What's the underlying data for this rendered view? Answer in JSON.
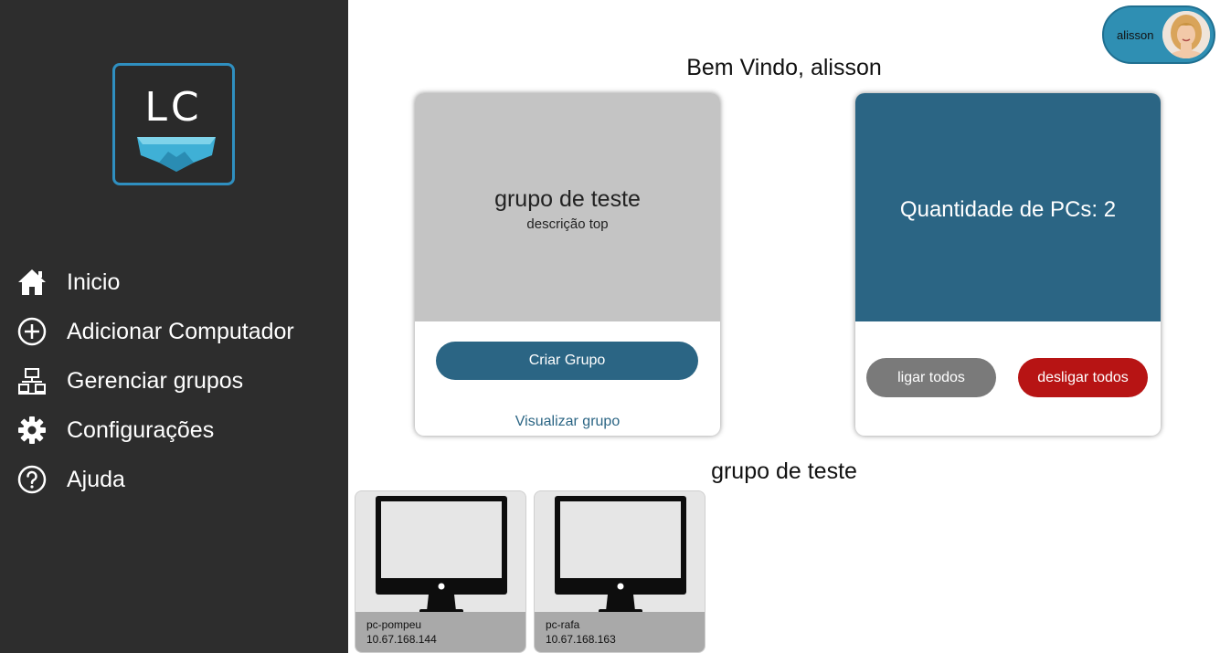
{
  "app": {
    "logo_text": "LC",
    "accent_color": "#2f8fc0",
    "sidebar_bg": "#2d2d2d"
  },
  "sidebar": {
    "items": [
      {
        "label": "Inicio",
        "icon": "home-icon"
      },
      {
        "label": "Adicionar Computador",
        "icon": "plus-circle-icon"
      },
      {
        "label": "Gerenciar grupos",
        "icon": "network-icon"
      },
      {
        "label": "Configurações",
        "icon": "gear-icon"
      },
      {
        "label": "Ajuda",
        "icon": "help-icon"
      }
    ]
  },
  "user": {
    "name": "alisson"
  },
  "header": {
    "welcome": "Bem Vindo, alisson"
  },
  "group_card": {
    "title": "grupo de teste",
    "description": "descrição top",
    "create_button": "Criar Grupo",
    "view_link": "Visualizar grupo"
  },
  "pcs_card": {
    "count_text": "Quantidade de PCs: 2",
    "on_button": "ligar todos",
    "off_button": "desligar todos",
    "on_color": "#7a7a7a",
    "off_color": "#b71414"
  },
  "section": {
    "title": "grupo de teste"
  },
  "computers": [
    {
      "name": "pc-pompeu",
      "ip": "10.67.168.144"
    },
    {
      "name": "pc-rafa",
      "ip": "10.67.168.163"
    }
  ]
}
